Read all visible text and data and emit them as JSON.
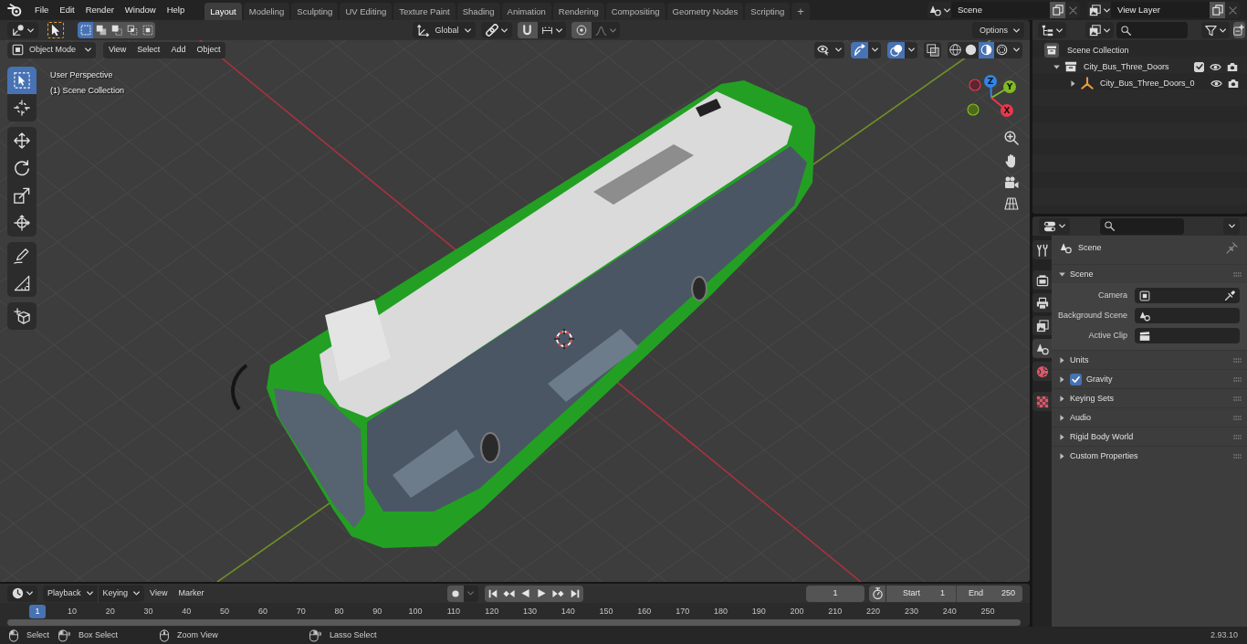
{
  "top_bar": {
    "menus": [
      "File",
      "Edit",
      "Render",
      "Window",
      "Help"
    ],
    "workspaces": [
      {
        "label": "Layout",
        "selected": true
      },
      {
        "label": "Modeling",
        "selected": false
      },
      {
        "label": "Sculpting",
        "selected": false
      },
      {
        "label": "UV Editing",
        "selected": false
      },
      {
        "label": "Texture Paint",
        "selected": false
      },
      {
        "label": "Shading",
        "selected": false
      },
      {
        "label": "Animation",
        "selected": false
      },
      {
        "label": "Rendering",
        "selected": false
      },
      {
        "label": "Compositing",
        "selected": false
      },
      {
        "label": "Geometry Nodes",
        "selected": false
      },
      {
        "label": "Scripting",
        "selected": false
      }
    ],
    "add_workspace": "+",
    "scene": "Scene",
    "view_layer": "View Layer"
  },
  "tool_header": {
    "select_modes": [
      {
        "kind": "set",
        "selected": true
      },
      {
        "kind": "extend",
        "selected": false
      },
      {
        "kind": "subtract",
        "selected": false
      },
      {
        "kind": "difference",
        "selected": false
      },
      {
        "kind": "intersect",
        "selected": false
      }
    ],
    "orientation": "Global",
    "options": "Options"
  },
  "viewport": {
    "mode": "Object Mode",
    "menus": [
      "View",
      "Select",
      "Add",
      "Object"
    ],
    "toggles": [
      {
        "kind": "visibility",
        "on": false
      },
      {
        "kind": "gizmo",
        "on": true
      },
      {
        "kind": "overlay",
        "on": true
      },
      {
        "kind": "xray",
        "on": false
      }
    ],
    "shading": [
      {
        "kind": "wireframe",
        "selected": false
      },
      {
        "kind": "solid",
        "selected": false
      },
      {
        "kind": "material",
        "selected": true
      },
      {
        "kind": "rendered",
        "selected": false
      }
    ],
    "info": [
      "User Perspective",
      "(1) Scene Collection"
    ],
    "tool_groups": [
      {
        "tools": [
          {
            "kind": "select_box",
            "selected": true
          },
          {
            "kind": "cursor",
            "selected": false
          }
        ]
      },
      {
        "tools": [
          {
            "kind": "move",
            "selected": false
          },
          {
            "kind": "rotate",
            "selected": false
          },
          {
            "kind": "scale",
            "selected": false
          },
          {
            "kind": "transform",
            "selected": false
          }
        ]
      },
      {
        "tools": [
          {
            "kind": "annotate",
            "selected": false
          },
          {
            "kind": "measure",
            "selected": false
          }
        ]
      },
      {
        "tools": [
          {
            "kind": "add_cube",
            "selected": false
          }
        ]
      }
    ],
    "gizmo_axes": [
      {
        "label": "Z",
        "color": "#2f86e6"
      },
      {
        "label": "Y",
        "color": "#80bb22"
      },
      {
        "label": "X",
        "color": "#e8384f"
      }
    ]
  },
  "outliner": {
    "root": "Scene Collection",
    "items": [
      {
        "kind": "collection",
        "label": "City_Bus_Three_Doors",
        "expanded": true,
        "checked": true,
        "children": [
          {
            "kind": "object",
            "label": "City_Bus_Three_Doors_0",
            "expanded": false
          }
        ]
      }
    ]
  },
  "properties": {
    "tab_groups": [
      {
        "tabs": [
          {
            "kind": "tool",
            "selected": false
          }
        ]
      },
      {
        "tabs": [
          {
            "kind": "render",
            "selected": false
          },
          {
            "kind": "output",
            "selected": false
          },
          {
            "kind": "view_layer",
            "selected": false
          },
          {
            "kind": "scene",
            "selected": true
          },
          {
            "kind": "world",
            "selected": false
          }
        ]
      },
      {
        "tabs": [
          {
            "kind": "texture",
            "selected": false
          }
        ]
      }
    ],
    "context": "Scene",
    "panels": [
      {
        "kind": "panel",
        "label": "Scene",
        "expanded": true,
        "fields": [
          {
            "kind": "camera",
            "label": "Camera"
          },
          {
            "kind": "scene",
            "label": "Background Scene"
          },
          {
            "kind": "clip",
            "label": "Active Clip"
          }
        ]
      },
      {
        "kind": "panel",
        "label": "Units",
        "expanded": false
      },
      {
        "kind": "checkbox_panel",
        "label": "Gravity",
        "expanded": false,
        "checked": true
      },
      {
        "kind": "panel",
        "label": "Keying Sets",
        "expanded": false
      },
      {
        "kind": "panel",
        "label": "Audio",
        "expanded": false
      },
      {
        "kind": "panel",
        "label": "Rigid Body World",
        "expanded": false
      },
      {
        "kind": "panel",
        "label": "Custom Properties",
        "expanded": false
      }
    ]
  },
  "timeline": {
    "dropdowns": [
      "Playback",
      "Keying"
    ],
    "menus": [
      "View",
      "Marker"
    ],
    "current_frame": "1",
    "start": {
      "label": "Start",
      "value": "1"
    },
    "end": {
      "label": "End",
      "value": "250"
    },
    "playhead": "1",
    "ticks": [
      "10",
      "20",
      "30",
      "40",
      "50",
      "60",
      "70",
      "80",
      "90",
      "100",
      "110",
      "120",
      "130",
      "140",
      "150",
      "160",
      "170",
      "180",
      "190",
      "200",
      "210",
      "220",
      "230",
      "240",
      "250"
    ]
  },
  "status_bar": {
    "hints": [
      {
        "kind": "left_click",
        "label": "Select"
      },
      {
        "kind": "left_drag",
        "label": "Box Select"
      },
      {
        "kind": "middle_click",
        "label": "Zoom View"
      },
      {
        "kind": "right_drag",
        "label": "Lasso Select"
      }
    ],
    "version": "2.93.10"
  }
}
